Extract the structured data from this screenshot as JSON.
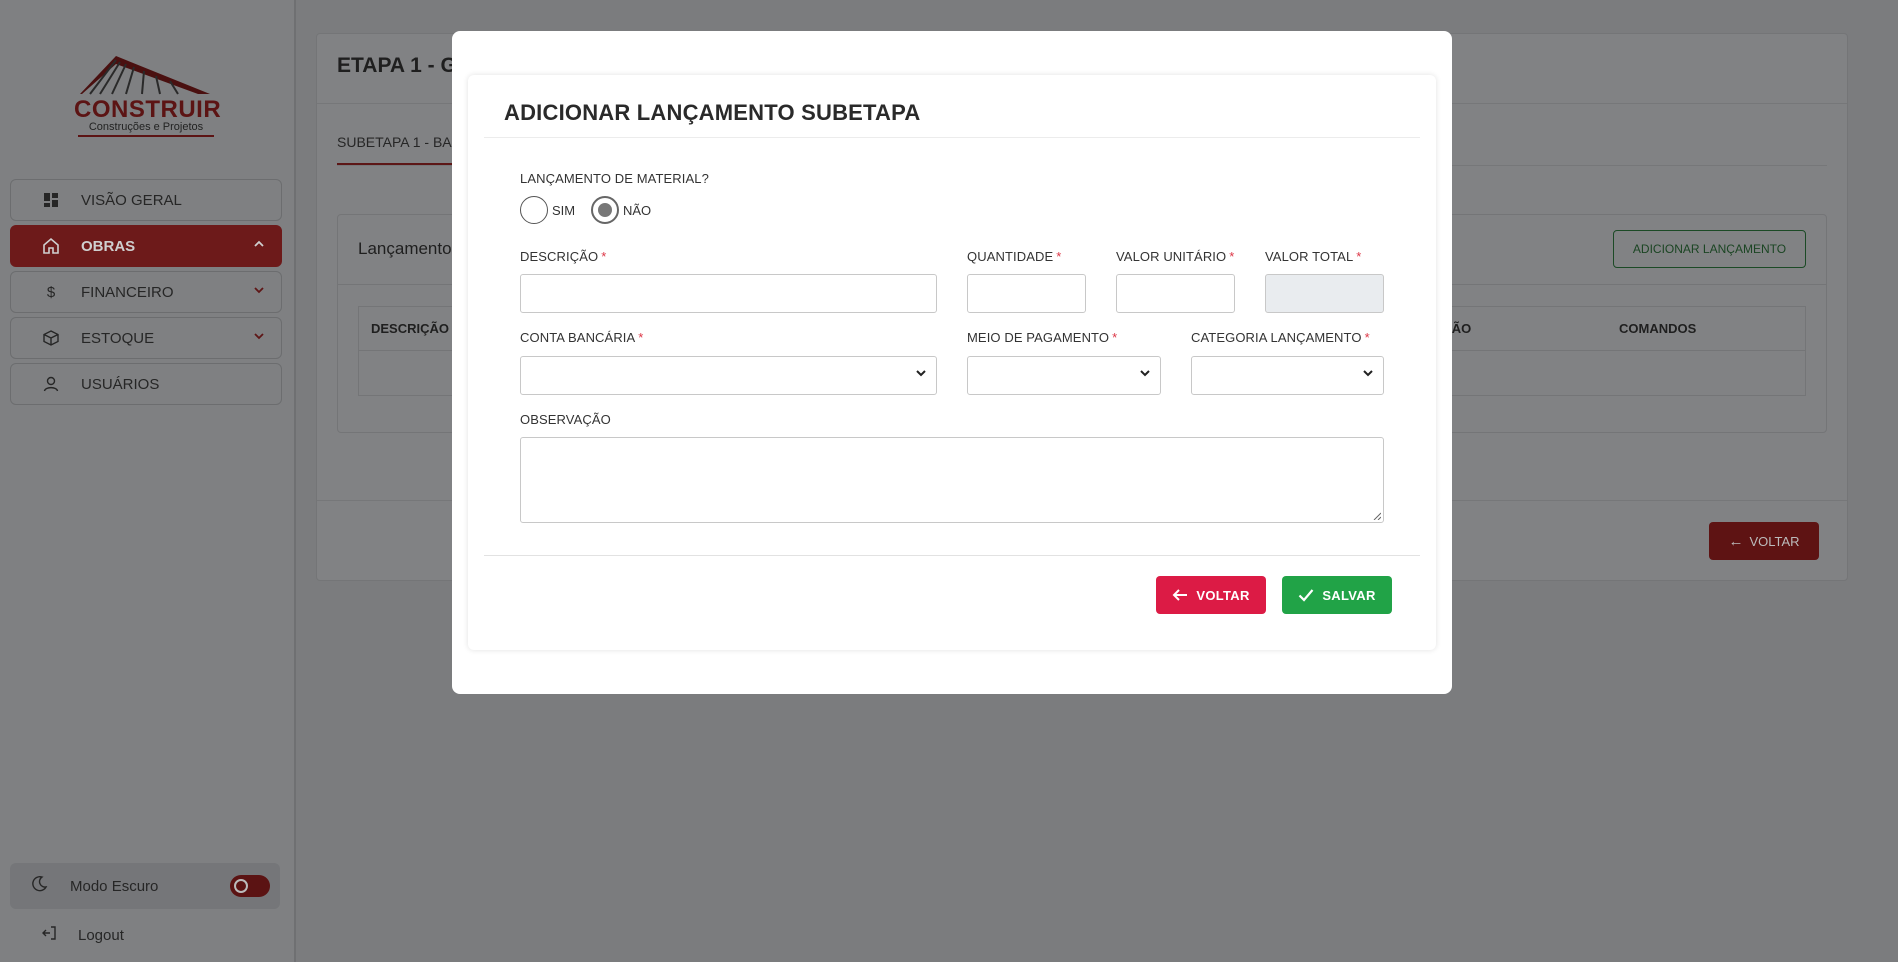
{
  "app": {
    "brand": "CONSTRUIR",
    "brand_sub": "Construções e Projetos"
  },
  "sidebar": {
    "items": [
      {
        "label": "VISÃO GERAL",
        "icon": "dashboard-icon"
      },
      {
        "label": "OBRAS",
        "icon": "home-icon",
        "active": true
      },
      {
        "label": "FINANCEIRO",
        "icon": "dollar-icon"
      },
      {
        "label": "ESTOQUE",
        "icon": "box-icon"
      },
      {
        "label": "USUÁRIOS",
        "icon": "user-icon"
      }
    ],
    "dark_mode_label": "Modo Escuro",
    "logout_label": "Logout"
  },
  "background": {
    "page_title": "ETAPA 1 - G",
    "subtab_label": "SUBETAPA 1 - BA",
    "card_title": "Lançamento",
    "add_button": "ADICIONAR LANÇAMENTO",
    "table_headers": [
      "DESCRIÇÃO",
      "AÇÃO",
      "COMANDOS"
    ],
    "voltar_button": "VOLTAR"
  },
  "modal": {
    "title": "ADICIONAR LANÇAMENTO SUBETAPA",
    "material_question": "LANÇAMENTO DE MATERIAL?",
    "radio_yes": "SIM",
    "radio_no": "NÃO",
    "selected_radio": "NÃO",
    "fields": {
      "descricao": {
        "label": "DESCRIÇÃO",
        "required_mark": "*",
        "value": ""
      },
      "quantidade": {
        "label": "QUANTIDADE",
        "required_mark": "*",
        "value": ""
      },
      "valor_unitario": {
        "label": "VALOR UNITÁRIO",
        "required_mark": "*",
        "value": ""
      },
      "valor_total": {
        "label": "VALOR TOTAL",
        "required_mark": "*",
        "value": ""
      },
      "conta_bancaria": {
        "label": "CONTA BANCÁRIA",
        "required_mark": "*",
        "value": ""
      },
      "meio_pagamento": {
        "label": "MEIO DE PAGAMENTO",
        "required_mark": "*",
        "value": ""
      },
      "categoria": {
        "label": "CATEGORIA LANÇAMENTO",
        "required_mark": "*",
        "value": ""
      },
      "observacao": {
        "label": "OBSERVAÇÃO",
        "value": ""
      }
    },
    "voltar_button": "VOLTAR",
    "salvar_button": "SALVAR"
  },
  "colors": {
    "primary_red": "#dc1b45",
    "success_green": "#21a347",
    "required": "#dc3545",
    "overlay": "#7b7c7e"
  }
}
